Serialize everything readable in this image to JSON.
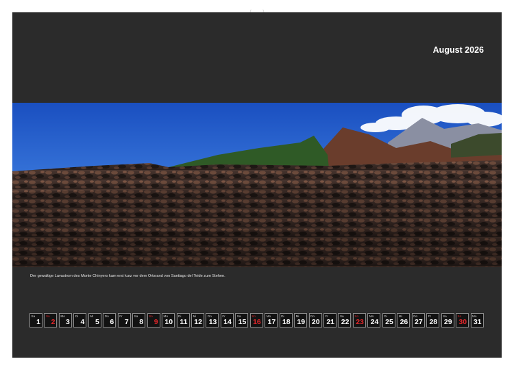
{
  "calendar": {
    "month_title": "August 2026",
    "caption": "Der gewaltige Lavastrom des Monte Chinyero kam erst kurz vor dem Ortsrand von Santiago del Teide zum Stehen.",
    "sunday_color": "#e0262a",
    "days": [
      {
        "dow": "Sa",
        "num": "1",
        "sunday": false
      },
      {
        "dow": "So",
        "num": "2",
        "sunday": true
      },
      {
        "dow": "Mo",
        "num": "3",
        "sunday": false
      },
      {
        "dow": "Di",
        "num": "4",
        "sunday": false
      },
      {
        "dow": "Mi",
        "num": "5",
        "sunday": false
      },
      {
        "dow": "Do",
        "num": "6",
        "sunday": false
      },
      {
        "dow": "Fr",
        "num": "7",
        "sunday": false
      },
      {
        "dow": "Sa",
        "num": "8",
        "sunday": false
      },
      {
        "dow": "So",
        "num": "9",
        "sunday": true
      },
      {
        "dow": "Mo",
        "num": "10",
        "sunday": false
      },
      {
        "dow": "Di",
        "num": "11",
        "sunday": false
      },
      {
        "dow": "Mi",
        "num": "12",
        "sunday": false
      },
      {
        "dow": "Do",
        "num": "13",
        "sunday": false
      },
      {
        "dow": "Fr",
        "num": "14",
        "sunday": false
      },
      {
        "dow": "Sa",
        "num": "15",
        "sunday": false
      },
      {
        "dow": "So",
        "num": "16",
        "sunday": true
      },
      {
        "dow": "Mo",
        "num": "17",
        "sunday": false
      },
      {
        "dow": "Di",
        "num": "18",
        "sunday": false
      },
      {
        "dow": "Mi",
        "num": "19",
        "sunday": false
      },
      {
        "dow": "Do",
        "num": "20",
        "sunday": false
      },
      {
        "dow": "Fr",
        "num": "21",
        "sunday": false
      },
      {
        "dow": "Sa",
        "num": "22",
        "sunday": false
      },
      {
        "dow": "So",
        "num": "23",
        "sunday": true
      },
      {
        "dow": "Mo",
        "num": "24",
        "sunday": false
      },
      {
        "dow": "Di",
        "num": "25",
        "sunday": false
      },
      {
        "dow": "Mi",
        "num": "26",
        "sunday": false
      },
      {
        "dow": "Do",
        "num": "27",
        "sunday": false
      },
      {
        "dow": "Fr",
        "num": "28",
        "sunday": false
      },
      {
        "dow": "Sa",
        "num": "29",
        "sunday": false
      },
      {
        "dow": "So",
        "num": "30",
        "sunday": true
      },
      {
        "dow": "Mo",
        "num": "31",
        "sunday": false
      }
    ]
  }
}
